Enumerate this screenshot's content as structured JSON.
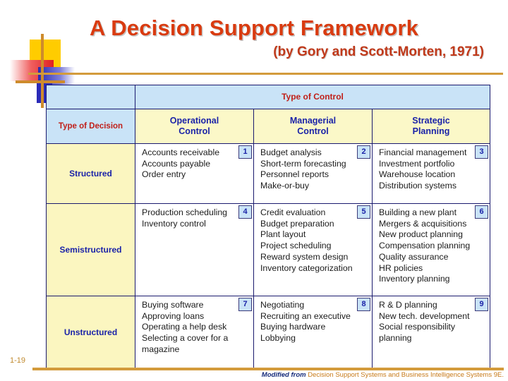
{
  "slide": {
    "title": "A Decision Support Framework",
    "subtitle": "(by Gory and Scott-Morten, 1971)",
    "number": "1-19",
    "credit_lead": "Modified from",
    "credit_rest": "Decision Support Systems and Business Intelligence Systems 9E."
  },
  "colors": {
    "title_red": "#D93B10",
    "subtitle_red": "#C0391A",
    "header_blue_bg": "#C9E3F7",
    "header_yellow_bg": "#FBF8C8",
    "label_yellow_bg": "#FBF6C0",
    "heading_text_red": "#C0201A",
    "heading_text_blue": "#1B23A8",
    "rule_orange": "#D39B3C",
    "border_navy": "#1a1a6e"
  },
  "table": {
    "control_header": "Type of Control",
    "decision_header": "Type of Decision",
    "columns": [
      {
        "label": "Operational\nControl"
      },
      {
        "label": "Managerial\nControl"
      },
      {
        "label": "Strategic\nPlanning"
      }
    ],
    "rows": [
      {
        "label": "Structured",
        "cells": [
          {
            "badge": "1",
            "items": [
              "Accounts receivable",
              "Accounts payable",
              "Order entry"
            ]
          },
          {
            "badge": "2",
            "items": [
              "Budget analysis",
              "Short-term forecasting",
              "Personnel reports",
              "Make-or-buy"
            ]
          },
          {
            "badge": "3",
            "items": [
              "Financial management",
              "Investment portfolio",
              "Warehouse location",
              "Distribution systems"
            ]
          }
        ]
      },
      {
        "label": "Semistructured",
        "cells": [
          {
            "badge": "4",
            "items": [
              "Production scheduling",
              "Inventory control"
            ]
          },
          {
            "badge": "5",
            "items": [
              "Credit evaluation",
              "Budget preparation",
              "Plant layout",
              "Project scheduling",
              "Reward system design",
              "Inventory categorization"
            ]
          },
          {
            "badge": "6",
            "items": [
              "Building a new plant",
              "Mergers & acquisitions",
              "New product planning",
              "Compensation planning",
              "Quality assurance",
              "HR policies",
              "Inventory planning"
            ]
          }
        ]
      },
      {
        "label": "Unstructured",
        "cells": [
          {
            "badge": "7",
            "items": [
              "Buying software",
              "Approving loans",
              "Operating a help desk",
              "Selecting a cover for a\n   magazine"
            ]
          },
          {
            "badge": "8",
            "items": [
              "Negotiating",
              "Recruiting an executive",
              "Buying hardware",
              "Lobbying"
            ]
          },
          {
            "badge": "9",
            "items": [
              "R & D planning",
              "New tech. development",
              "Social responsibility\n   planning"
            ]
          }
        ]
      }
    ]
  }
}
